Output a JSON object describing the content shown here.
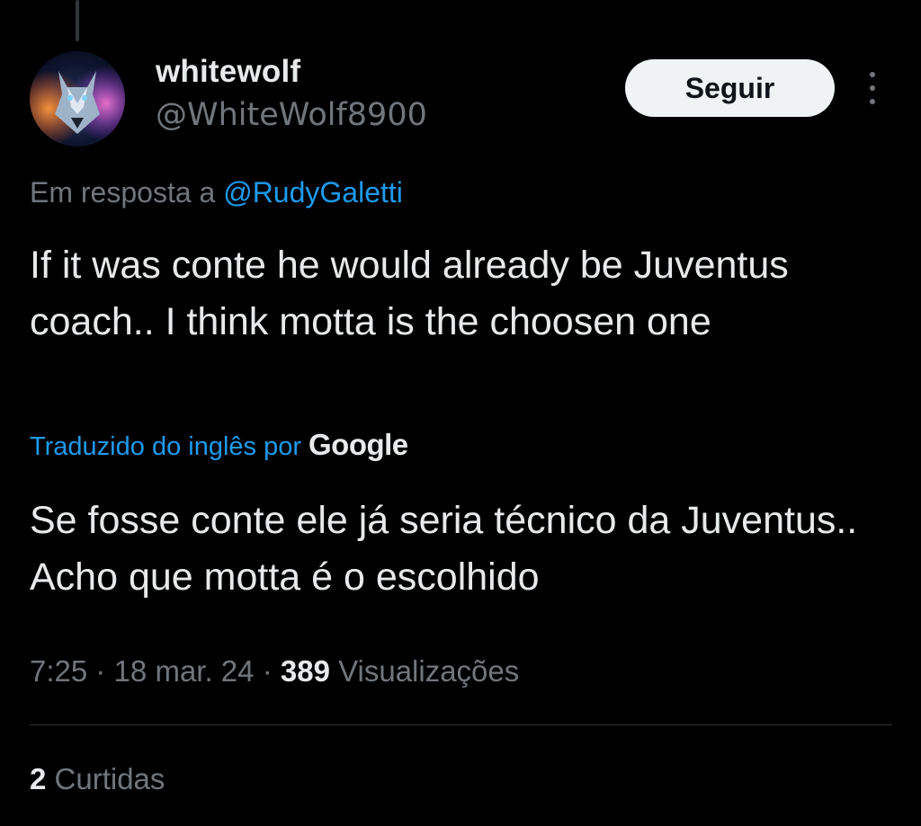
{
  "author": {
    "display_name": "whitewolf",
    "handle": "@WhiteWolf8900",
    "avatar_icon": "wolf-avatar"
  },
  "follow_button": {
    "label": "Seguir"
  },
  "more_icon": "more-vertical-icon",
  "reply_context": {
    "prefix": "Em resposta a",
    "mention": "@RudyGaletti"
  },
  "tweet": {
    "text": "If it was conte he would already be Juventus coach.. I think motta is the choosen one",
    "translation_label": "Traduzido do inglês por",
    "translation_provider": "Google",
    "translated_text": "Se fosse conte ele já seria técnico da Juventus.. Acho que motta é o escolhido"
  },
  "meta": {
    "time": "7:25",
    "separator": "·",
    "date": "18 mar. 24",
    "views_count": "389",
    "views_label": "Visualizações"
  },
  "likes": {
    "count": "2",
    "label": "Curtidas"
  },
  "colors": {
    "background": "#000000",
    "text_primary": "#e7e9ea",
    "text_secondary": "#71767b",
    "accent": "#1d9bf0",
    "button_bg": "#eff3f4",
    "divider": "#2f3336"
  }
}
